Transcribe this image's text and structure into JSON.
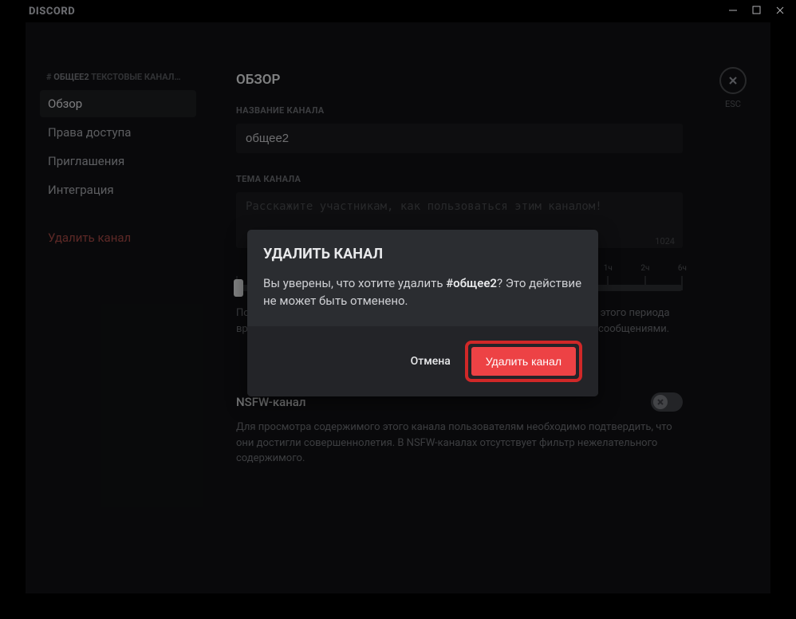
{
  "app": {
    "logo": "DISCORD"
  },
  "close": {
    "label": "ESC"
  },
  "sidebar": {
    "header_prefix": "# ",
    "header_channel": "ОБЩЕЕ2",
    "header_suffix": " ТЕКСТОВЫЕ КАНАЛ…",
    "items": [
      {
        "label": "Обзор"
      },
      {
        "label": "Права доступа"
      },
      {
        "label": "Приглашения"
      },
      {
        "label": "Интеграция"
      }
    ],
    "delete_label": "Удалить канал"
  },
  "content": {
    "page_title": "ОБЗОР",
    "name_label": "НАЗВАНИЕ КАНАЛА",
    "name_value": "общее2",
    "topic_label": "ТЕМА КАНАЛА",
    "topic_placeholder": "Расскажите участникам, как пользоваться этим каналом!",
    "topic_counter": "1024",
    "slowmode_helper": "Пользователи не смогут отправлять больше одного сообщения в течение этого периода времени, кроме случаев, когда у них есть права управления каналом или сообщениями.",
    "slider_ticks": [
      "",
      "",
      "",
      "",
      "",
      "",
      "",
      "",
      "",
      "",
      "1ч",
      "2ч",
      "6ч"
    ],
    "nsfw_title": "NSFW-канал",
    "nsfw_helper": "Для просмотра содержимого этого канала пользователям необходимо подтвердить, что они достигли совершеннолетия. В NSFW-каналах отсутствует фильтр нежелательного содержимого."
  },
  "modal": {
    "title": "УДАЛИТЬ КАНАЛ",
    "text_before": "Вы уверены, что хотите удалить ",
    "text_bold": "#общее2",
    "text_after": "? Это действие не может быть отменено.",
    "cancel": "Отмена",
    "confirm": "Удалить канал"
  }
}
